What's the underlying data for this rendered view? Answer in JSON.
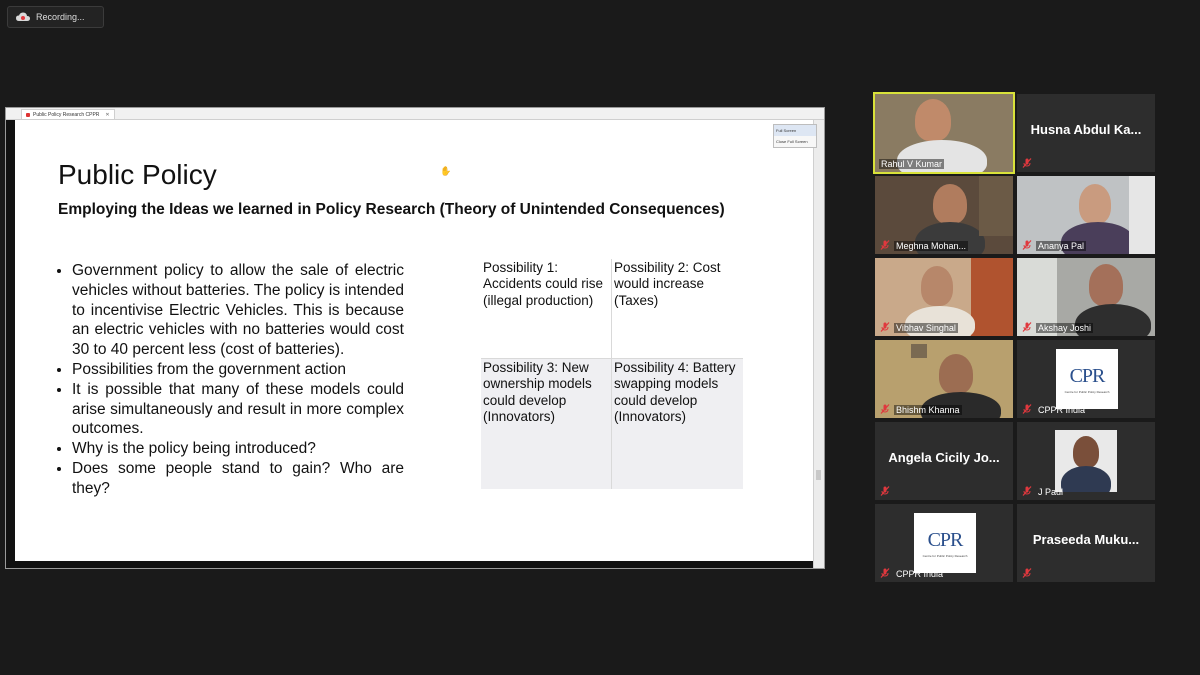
{
  "recording": {
    "label": "Recording..."
  },
  "share": {
    "tab_label": "Public Policy Research CPPR",
    "fullscreen_menu": [
      "Full Screen",
      "Close Full Screen"
    ],
    "slide": {
      "title": "Public Policy",
      "subtitle": "Employing the Ideas we learned in Policy Research (Theory of Unintended Consequences)",
      "bullets": [
        "Government policy to allow the sale of electric vehicles without batteries. The policy is intended to incentivise Electric Vehicles. This is because an electric vehicles with no batteries would cost 30 to 40 percent less (cost of batteries).",
        "Possibilities from the government action",
        "It is possible that many of these models could arise simultaneously and result in more complex outcomes.",
        "Why is the policy being introduced?",
        "Does some people stand to gain? Who are they?"
      ],
      "possibilities": [
        "Possibility 1: Accidents could rise (illegal production)",
        "Possibility 2: Cost would increase (Taxes)",
        "Possibility 3: New ownership models could develop (Innovators)",
        "Possibility 4: Battery swapping models could develop (Innovators)"
      ]
    }
  },
  "participants": [
    {
      "name": "Rahul V Kumar",
      "type": "video",
      "active": true
    },
    {
      "name": "Husna Abdul Ka...",
      "type": "name"
    },
    {
      "name": "Meghna Mohan...",
      "type": "video"
    },
    {
      "name": "Ananya Pal",
      "type": "video"
    },
    {
      "name": "Vibhav Singhal",
      "type": "video"
    },
    {
      "name": "Akshay Joshi",
      "type": "video"
    },
    {
      "name": "Bhishm Khanna",
      "type": "video"
    },
    {
      "name": "CPPR India",
      "type": "logo"
    },
    {
      "name": "Angela Cicily Jo...",
      "type": "name"
    },
    {
      "name": "J Paul",
      "type": "photo"
    },
    {
      "name": "CPPR India",
      "type": "logo"
    },
    {
      "name": "Praseeda Muku...",
      "type": "name"
    }
  ],
  "logo": {
    "text": "CPR",
    "subtitle": "Centre for Public Policy Research"
  },
  "colors": {
    "active_speaker": "#d9e23a",
    "muted_icon": "#e0383e",
    "background": "#1a1a1a"
  }
}
